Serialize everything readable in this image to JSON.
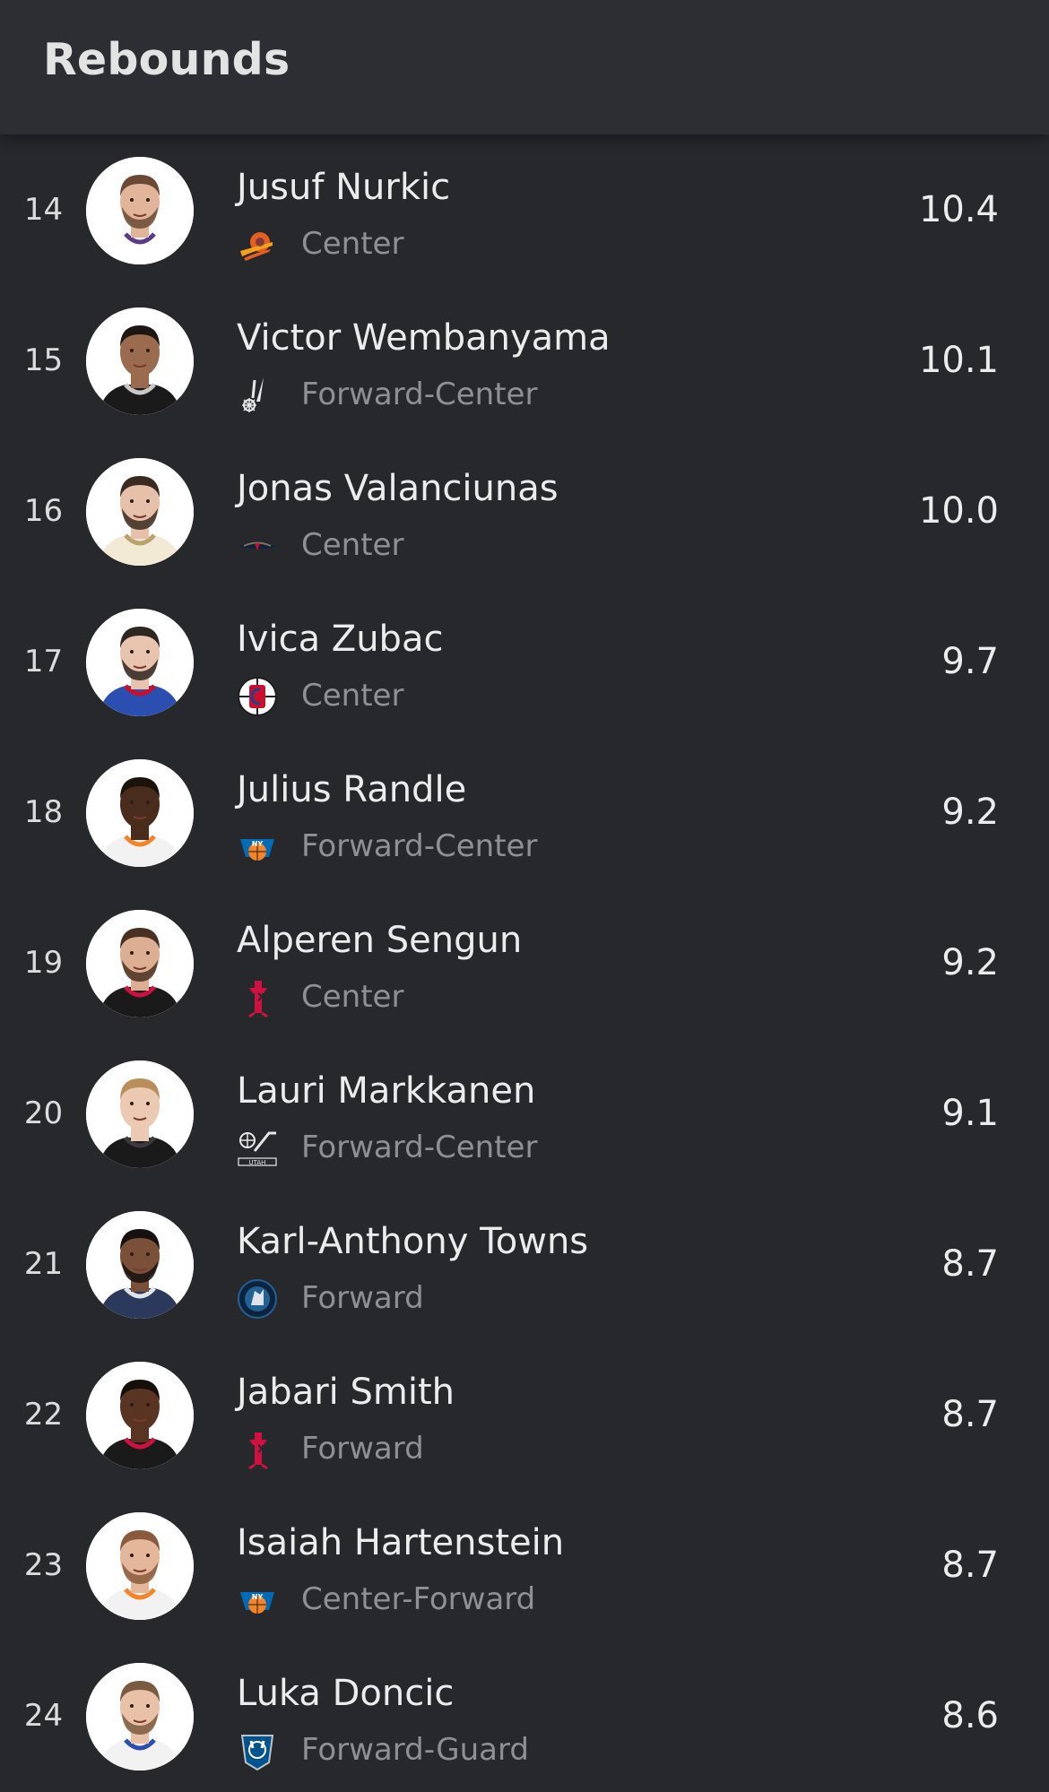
{
  "header": {
    "title": "Rebounds"
  },
  "players": [
    {
      "rank": "14",
      "name": "Jusuf Nurkic",
      "position": "Center",
      "value": "10.4",
      "team_icon": "suns-logo-icon",
      "skin": "#e2b59b",
      "hair": "#6b4a35",
      "jersey": "#ffffff",
      "trim": "#5b3a8a",
      "beard": true
    },
    {
      "rank": "15",
      "name": "Victor Wembanyama",
      "position": "Forward-Center",
      "value": "10.1",
      "team_icon": "spurs-logo-icon",
      "skin": "#9a6b4e",
      "hair": "#1e1613",
      "jersey": "#1a1a1a",
      "trim": "#c8c8c8",
      "beard": false
    },
    {
      "rank": "16",
      "name": "Jonas Valanciunas",
      "position": "Center",
      "value": "10.0",
      "team_icon": "pelicans-logo-icon",
      "skin": "#e6c0a8",
      "hair": "#3a2a20",
      "jersey": "#f3ead6",
      "trim": "#b8a36c",
      "beard": true
    },
    {
      "rank": "17",
      "name": "Ivica Zubac",
      "position": "Center",
      "value": "9.7",
      "team_icon": "clippers-logo-icon",
      "skin": "#e8c4ae",
      "hair": "#2e2620",
      "jersey": "#2a4fb0",
      "trim": "#c8102e",
      "beard": true
    },
    {
      "rank": "18",
      "name": "Julius Randle",
      "position": "Forward-Center",
      "value": "9.2",
      "team_icon": "knicks-logo-icon",
      "skin": "#4a2c1d",
      "hair": "#1c120c",
      "jersey": "#f2f2f2",
      "trim": "#f58426",
      "beard": false
    },
    {
      "rank": "19",
      "name": "Alperen Sengun",
      "position": "Center",
      "value": "9.2",
      "team_icon": "rockets-logo-icon",
      "skin": "#dcae92",
      "hair": "#4a3020",
      "jersey": "#1a1a1a",
      "trim": "#ce1141",
      "beard": true
    },
    {
      "rank": "20",
      "name": "Lauri Markkanen",
      "position": "Forward-Center",
      "value": "9.1",
      "team_icon": "jazz-logo-icon",
      "skin": "#ecc9b2",
      "hair": "#b98e5a",
      "jersey": "#1a1a1a",
      "trim": "#3a3a3a",
      "beard": false
    },
    {
      "rank": "21",
      "name": "Karl-Anthony Towns",
      "position": "Forward",
      "value": "8.7",
      "team_icon": "timberwolves-logo-icon",
      "skin": "#7a5039",
      "hair": "#161010",
      "jersey": "#2b3a5c",
      "trim": "#dfe3ea",
      "beard": true
    },
    {
      "rank": "22",
      "name": "Jabari Smith",
      "position": "Forward",
      "value": "8.7",
      "team_icon": "rockets-logo-icon",
      "skin": "#5a3423",
      "hair": "#150e0a",
      "jersey": "#1a1a1a",
      "trim": "#ce1141",
      "beard": false
    },
    {
      "rank": "23",
      "name": "Isaiah Hartenstein",
      "position": "Center-Forward",
      "value": "8.7",
      "team_icon": "knicks-logo-icon",
      "skin": "#e4b69a",
      "hair": "#8a5a3c",
      "jersey": "#f2f2f2",
      "trim": "#f58426",
      "beard": true
    },
    {
      "rank": "24",
      "name": "Luka Doncic",
      "position": "Forward-Guard",
      "value": "8.6",
      "team_icon": "mavericks-logo-icon",
      "skin": "#e8c1a8",
      "hair": "#7a5a40",
      "jersey": "#f2f2f2",
      "trim": "#2a4fb0",
      "beard": true
    }
  ],
  "colors": {
    "background": "#26282c",
    "header_background": "#2c2e33",
    "primary_text": "#ececed",
    "secondary_text": "#8f9094"
  }
}
